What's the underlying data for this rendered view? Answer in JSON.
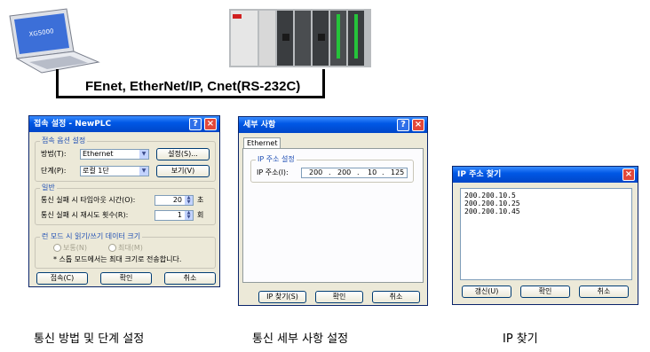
{
  "connection_label": "FEnet, EtherNet/IP, Cnet(RS-232C)",
  "laptop_brand": "XG5000",
  "dialog1": {
    "title": "접속 설정 - NewPLC",
    "group_connection": "접속 옵션 설정",
    "method_label": "방법(T):",
    "method_value": "Ethernet",
    "settings_button": "설정(S)...",
    "depth_label": "단계(P):",
    "depth_value": "로컬 1단",
    "view_button": "보기(V)",
    "group_general": "일반",
    "timeout_label": "통신 실패 시 타임아웃 시간(O):",
    "timeout_value": "20",
    "timeout_unit": "초",
    "retry_label": "통신 실패 시 재시도 횟수(R):",
    "retry_value": "1",
    "retry_unit": "회",
    "group_readwrite": "런 모드 시 읽기/쓰기 데이터 크기",
    "radio_normal": "보통(N)",
    "radio_max": "최대(M)",
    "note": "* 스톱 모드에서는 최대 크기로 전송합니다.",
    "connect_button": "접속(C)",
    "ok_button": "확인",
    "cancel_button": "취소"
  },
  "dialog2": {
    "title": "세부 사항",
    "tab_label": "Ethernet",
    "group_ip": "IP 주소 설정",
    "ip_label": "IP 주소(I):",
    "ip_octets": [
      "200",
      "200",
      "10",
      "125"
    ],
    "find_ip_button": "IP 찾기(S)",
    "ok_button": "확인",
    "cancel_button": "취소"
  },
  "dialog3": {
    "title": "IP 주소 찾기",
    "ip_list": [
      "200.200.10.5",
      "200.200.10.25",
      "200.200.10.45"
    ],
    "refresh_button": "갱신(U)",
    "ok_button": "확인",
    "cancel_button": "취소"
  },
  "captions": [
    "통신 방법 및 단계 설정",
    "통신 세부 사항 설정",
    "IP 찾기"
  ],
  "colors": {
    "titlebar": "#0058e6",
    "dialog_bg": "#ece9d8",
    "group_title": "#1f4fb4"
  }
}
